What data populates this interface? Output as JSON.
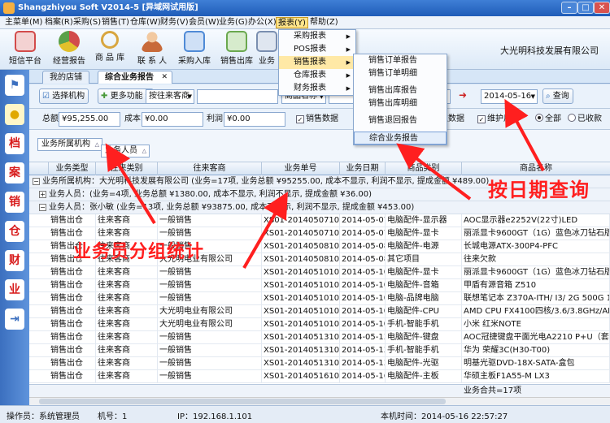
{
  "window": {
    "title": "Shangzhiyou Soft V2014-5 [异域网试用版]"
  },
  "menubar": [
    {
      "label": "主菜单(M)"
    },
    {
      "label": "档案(R)"
    },
    {
      "label": "采购(S)"
    },
    {
      "label": "销售(T)"
    },
    {
      "label": "仓库(W)"
    },
    {
      "label": "财务(V)"
    },
    {
      "label": "会员(W)"
    },
    {
      "label": "业务(G)"
    },
    {
      "label": "办公(X)"
    },
    {
      "label": "报表(Y)"
    },
    {
      "label": "帮助(Z)"
    }
  ],
  "toolbar": {
    "buttons": [
      {
        "label": "短信平台",
        "icon": "envelope-icon",
        "color": "#d24b4b"
      },
      {
        "label": "经营报告",
        "icon": "pie-chart-icon",
        "color": "#e2a12b"
      },
      {
        "label": "商 品 库",
        "icon": "magnifier-icon",
        "color": "#d8a640"
      },
      {
        "label": "联 系 人",
        "icon": "person-icon",
        "color": "#c86a3a"
      },
      {
        "label": "采购入库",
        "icon": "cart-icon",
        "color": "#4f8ad6"
      },
      {
        "label": "销售出库",
        "icon": "box-icon",
        "color": "#6aa84f"
      },
      {
        "label": "业务",
        "icon": "report-icon",
        "color": "#7a8fb0"
      }
    ],
    "company": "大光明科技发展有限公司"
  },
  "sidebar": [
    {
      "label": "",
      "icon": "flag-icon"
    },
    {
      "label": "",
      "icon": "bulb-icon"
    },
    {
      "label": "档"
    },
    {
      "label": "案"
    },
    {
      "label": "销"
    },
    {
      "label": "仓"
    },
    {
      "label": "财"
    },
    {
      "label": "业"
    },
    {
      "label": "",
      "icon": "exit-icon"
    }
  ],
  "tabs": [
    {
      "label": "我的店铺"
    },
    {
      "label": "综合业务报告"
    }
  ],
  "filter1": {
    "select_org": "选择机构",
    "more": "更多功能",
    "customer_select": "按往来客商",
    "product_select": "商品名称",
    "date_to": "2014-05-16",
    "query": "查询"
  },
  "filter2": {
    "total_label": "总额",
    "total_value": "¥95,255.00",
    "cost_label": "成本",
    "cost_value": "¥0.00",
    "profit_label": "利润",
    "profit_value": "¥0.00",
    "cb_sales": "销售数据",
    "cb_unit": "单位数据",
    "cb_warranty": "维护用件",
    "r_all": "全部",
    "r_collected": "已收款"
  },
  "grouparea": {
    "chip1": "业务所属机构",
    "chip2": "业务人员"
  },
  "grid": {
    "headers": [
      "业务类型",
      "往来类别",
      "往来客商",
      "业务单号",
      "业务日期",
      "商品类别",
      "商品名称"
    ],
    "group1": "业务所属机构：大光明科技发展有限公司 (业务=17项, 业务总额 ¥95255.00, 成本不显示, 利润不显示, 提成金额 ¥489.00)",
    "group2": "业务人员：(业务=4项, 业务总额 ¥1380.00, 成本不显示, 利润不显示, 提成金额 ¥36.00)",
    "group3": "业务人员：张小敏 (业务=13项, 业务总额 ¥93875.00, 成本不显示, 利润不显示, 提成金额 ¥453.00)",
    "rows": [
      [
        "销售出仓",
        "往来客商",
        "一般销售",
        "XS01-201405071001",
        "2014-05-07",
        "电脑配件-显示器",
        "AOC显示器e2252V(22寸)LED"
      ],
      [
        "销售出仓",
        "往来客商",
        "一般销售",
        "XS01-201405071001",
        "2014-05-07",
        "电脑配件-显卡",
        "丽派显卡9600GT（1G）蓝色冰刀钻石版"
      ],
      [
        "销售出仓",
        "往来客商",
        "一般销售",
        "XS01-201405081001",
        "2014-05-08",
        "电脑配件-电源",
        "长城电源ATX-300P4-PFC"
      ],
      [
        "销售出仓",
        "往来客商",
        "大光明电业有限公司",
        "XS01-201405081002",
        "2014-05-08",
        "其它项目",
        "往来欠款"
      ],
      [
        "销售出仓",
        "往来客商",
        "一般销售",
        "XS01-201405101001",
        "2014-05-10",
        "电脑配件-显卡",
        "丽派显卡9600GT（1G）蓝色冰刀钻石版"
      ],
      [
        "销售出仓",
        "往来客商",
        "一般销售",
        "XS01-201405101001",
        "2014-05-10",
        "电脑配件-音箱",
        "甲盾有源音箱 Z510"
      ],
      [
        "销售出仓",
        "往来客商",
        "一般销售",
        "XS01-201405101001",
        "2014-05-10",
        "电脑-品牌电脑",
        "联想笔记本 Z370A-ITH/ I3/ 2G 500G 1G"
      ],
      [
        "销售出仓",
        "往来客商",
        "大光明电业有限公司",
        "XS01-201405101002",
        "2014-05-10",
        "电脑配件-CPU",
        "AMD CPU FX4100四核/3.6/3.8GHz/AM3+"
      ],
      [
        "销售出仓",
        "往来客商",
        "大光明电业有限公司",
        "XS01-201405101002",
        "2014-05-10",
        "手机-智能手机",
        "小米 红米NOTE"
      ],
      [
        "销售出仓",
        "往来客商",
        "一般销售",
        "XS01-201405131001",
        "2014-05-13",
        "电脑配件-键盘",
        "AOC冠捷键盘平面光电A2210 P+U（套）"
      ],
      [
        "销售出仓",
        "往来客商",
        "一般销售",
        "XS01-201405131001",
        "2014-05-13",
        "手机-智能手机",
        "华为 荣耀3C(H30-T00)"
      ],
      [
        "销售出仓",
        "往来客商",
        "一般销售",
        "XS01-201405131001",
        "2014-05-13",
        "电脑配件-光驱",
        "明基光驱DVD-18X-SATA-盒包"
      ],
      [
        "销售出仓",
        "往来客商",
        "一般销售",
        "XS01-201405161002",
        "2014-05-16",
        "电脑配件-主板",
        "华硕主板F1A55-M LX3"
      ]
    ],
    "footer": "业务合共=17项"
  },
  "statusbar": {
    "operator": "操作员：系统管理员",
    "machine": "机号：1",
    "ip": "IP：192.168.1.101",
    "time": "本机时间：2014-05-16 22:57:27"
  },
  "menus": {
    "report": [
      {
        "label": "采购报表"
      },
      {
        "label": "POS报表"
      },
      {
        "label": "销售报表"
      },
      {
        "label": "仓库报表"
      },
      {
        "label": "财务报表"
      }
    ],
    "sales_sub": [
      {
        "label": "销售订单报告"
      },
      {
        "label": "销售订单明细"
      },
      {
        "label": "销售出库报告"
      },
      {
        "label": "销售出库明细"
      },
      {
        "label": "销售退回报告"
      },
      {
        "label": "综合业务报告"
      }
    ]
  },
  "annotations": {
    "group_stats": "业务员分组统计",
    "date_query": "按日期查询"
  },
  "colors": {
    "accent": "#3b6fbf",
    "annotation": "#ff1f1f",
    "menu_highlight": "#ffe9a6"
  }
}
